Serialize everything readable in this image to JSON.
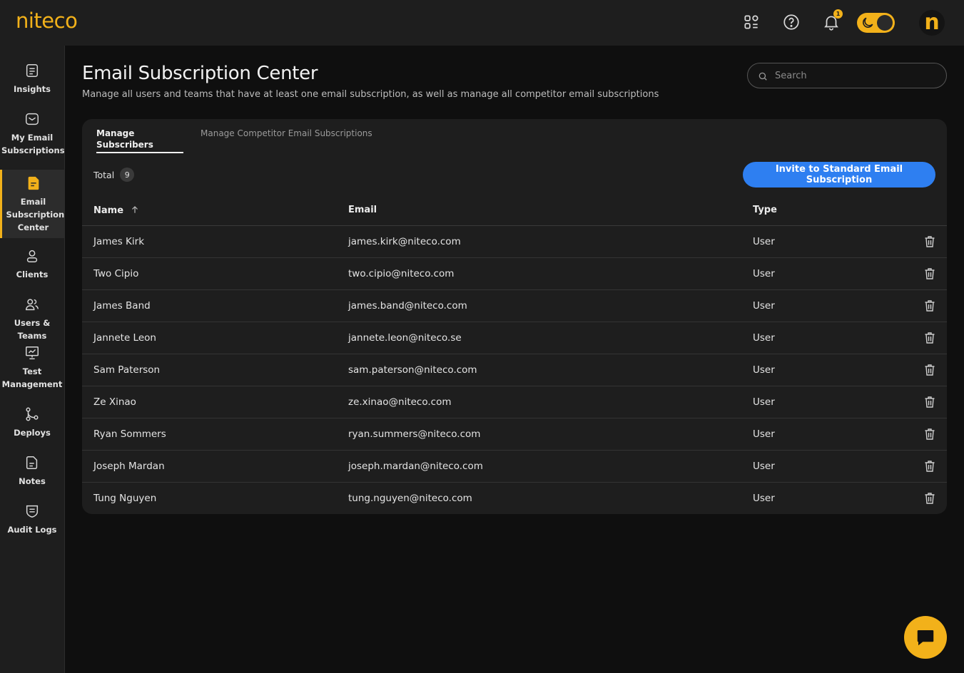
{
  "app": {
    "logo": "niteco",
    "notification_count": "1",
    "avatar_letter": "n",
    "accent_color": "#f2b11a",
    "primary_button_color": "#2e7ff1"
  },
  "topbar": {
    "icons": [
      "apps-grid-icon",
      "help-icon",
      "bell-icon",
      "moon-icon"
    ]
  },
  "sidebar": {
    "items": [
      {
        "label": "Insights",
        "icon": "document-list-icon"
      },
      {
        "label": "My Email Subscriptions",
        "icon": "email-check-icon"
      },
      {
        "label": "Email Subscription Center",
        "icon": "email-doc-icon",
        "active": true
      },
      {
        "label": "Clients",
        "icon": "user-icon"
      },
      {
        "label": "Users & Teams",
        "icon": "users-icon"
      },
      {
        "label": "Test Management",
        "icon": "presentation-chart-icon"
      },
      {
        "label": "Deploys",
        "icon": "git-branch-icon"
      },
      {
        "label": "Notes",
        "icon": "note-icon"
      },
      {
        "label": "Audit Logs",
        "icon": "shield-list-icon"
      }
    ]
  },
  "header": {
    "title": "Email Subscription Center",
    "subtitle": "Manage all users and teams that have at least one email subscription, as well as manage all competitor email subscriptions",
    "search_placeholder": "Search"
  },
  "tabs": [
    {
      "label": "Manage Subscribers",
      "active": true
    },
    {
      "label": "Manage Competitor Email Subscriptions",
      "active": false
    }
  ],
  "table": {
    "total_label": "Total",
    "total_count": "9",
    "invite_button": "Invite to Standard Email Subscription",
    "columns": [
      "Name",
      "Email",
      "Type"
    ],
    "rows": [
      {
        "name": "James Kirk",
        "email": "james.kirk@niteco.com",
        "type": "User"
      },
      {
        "name": "Two Cipio",
        "email": "two.cipio@niteco.com",
        "type": "User"
      },
      {
        "name": "James Band",
        "email": "james.band@niteco.com",
        "type": "User"
      },
      {
        "name": "Jannete Leon",
        "email": "jannete.leon@niteco.se",
        "type": "User"
      },
      {
        "name": "Sam Paterson",
        "email": "sam.paterson@niteco.com",
        "type": "User"
      },
      {
        "name": "Ze Xinao",
        "email": "ze.xinao@niteco.com",
        "type": "User"
      },
      {
        "name": "Ryan Sommers",
        "email": "ryan.summers@niteco.com",
        "type": "User"
      },
      {
        "name": "Joseph Mardan",
        "email": "joseph.mardan@niteco.com",
        "type": "User"
      },
      {
        "name": "Tung Nguyen",
        "email": "tung.nguyen@niteco.com",
        "type": "User"
      }
    ]
  }
}
